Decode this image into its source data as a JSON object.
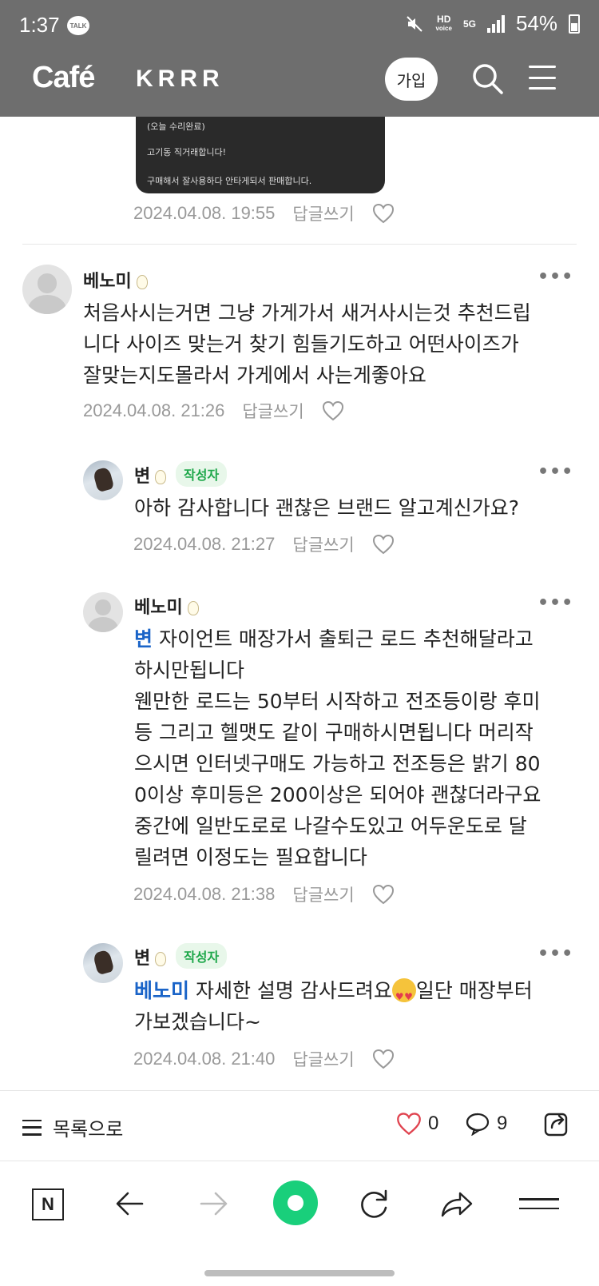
{
  "status": {
    "time": "1:37",
    "talk_badge": "TALK",
    "hd_top": "HD",
    "hd_bottom": "voice",
    "net": "5G",
    "battery": "54%"
  },
  "header": {
    "brand": "Café",
    "cafe_name": "KRRR",
    "join_label": "가입"
  },
  "image_card": {
    "line1": "(오늘 수리완료)",
    "line2": "고기동 직거래합니다!",
    "line3": "구매해서 잘사용하다 안타게되서 판매합니다."
  },
  "post_meta": {
    "date": "2024.04.08. 19:55",
    "reply": "답글쓰기"
  },
  "comments": [
    {
      "nick": "베노미",
      "text": "처음사시는거면 그냥 가게가서 새거사시는것 추천드립\n니다 사이즈 맞는거 찾기 힘들기도하고 어떤사이즈가\n잘맞는지도몰라서 가게에서 사는게좋아요",
      "date": "2024.04.08. 21:26",
      "reply": "답글쓰기"
    },
    {
      "nick": "변",
      "badge": "작성자",
      "text": "아하 감사합니다 괜찮은 브랜드 알고계신가요?",
      "date": "2024.04.08. 21:27",
      "reply": "답글쓰기"
    },
    {
      "nick": "베노미",
      "mention": "변",
      "text": " 자이언트 매장가서 출퇴근 로드 추천해달라고\n하시만됩니다\n웬만한 로드는 50부터 시작하고 전조등이랑 후미\n등 그리고 헬맷도 같이 구매하시면됩니다 머리작\n으시면 인터넷구매도 가능하고 전조등은 밝기 80\n0이상 후미등은 200이상은 되어야 괜찮더라구요\n중간에 일반도로로 나갈수도있고 어두운도로 달\n릴려면 이정도는 필요합니다",
      "date": "2024.04.08. 21:38",
      "reply": "답글쓰기"
    },
    {
      "nick": "변",
      "badge": "작성자",
      "mention": "베노미",
      "text_a": " 자세한 설명 감사드려요",
      "text_b": "일단 매장부터\n가보겠습니다~",
      "date": "2024.04.08. 21:40",
      "reply": "답글쓰기"
    }
  ],
  "actionbar": {
    "list_label": "목록으로",
    "like_count": "0",
    "comment_count": "9"
  },
  "icons": [
    "talk-icon",
    "mute-icon",
    "signal-icon",
    "battery-icon",
    "search-icon",
    "menu-icon",
    "heart-icon",
    "more-icon",
    "list-icon",
    "comment-icon",
    "share-icon",
    "naver-icon",
    "back-icon",
    "forward-icon",
    "home-icon",
    "refresh-icon",
    "share-arrow-icon"
  ],
  "colors": {
    "header_bg": "#6e6e6e",
    "mention": "#1a64c8",
    "author_badge": "#1fa84b",
    "like_heart": "#e0434f",
    "green_home": "#19cf7b"
  }
}
